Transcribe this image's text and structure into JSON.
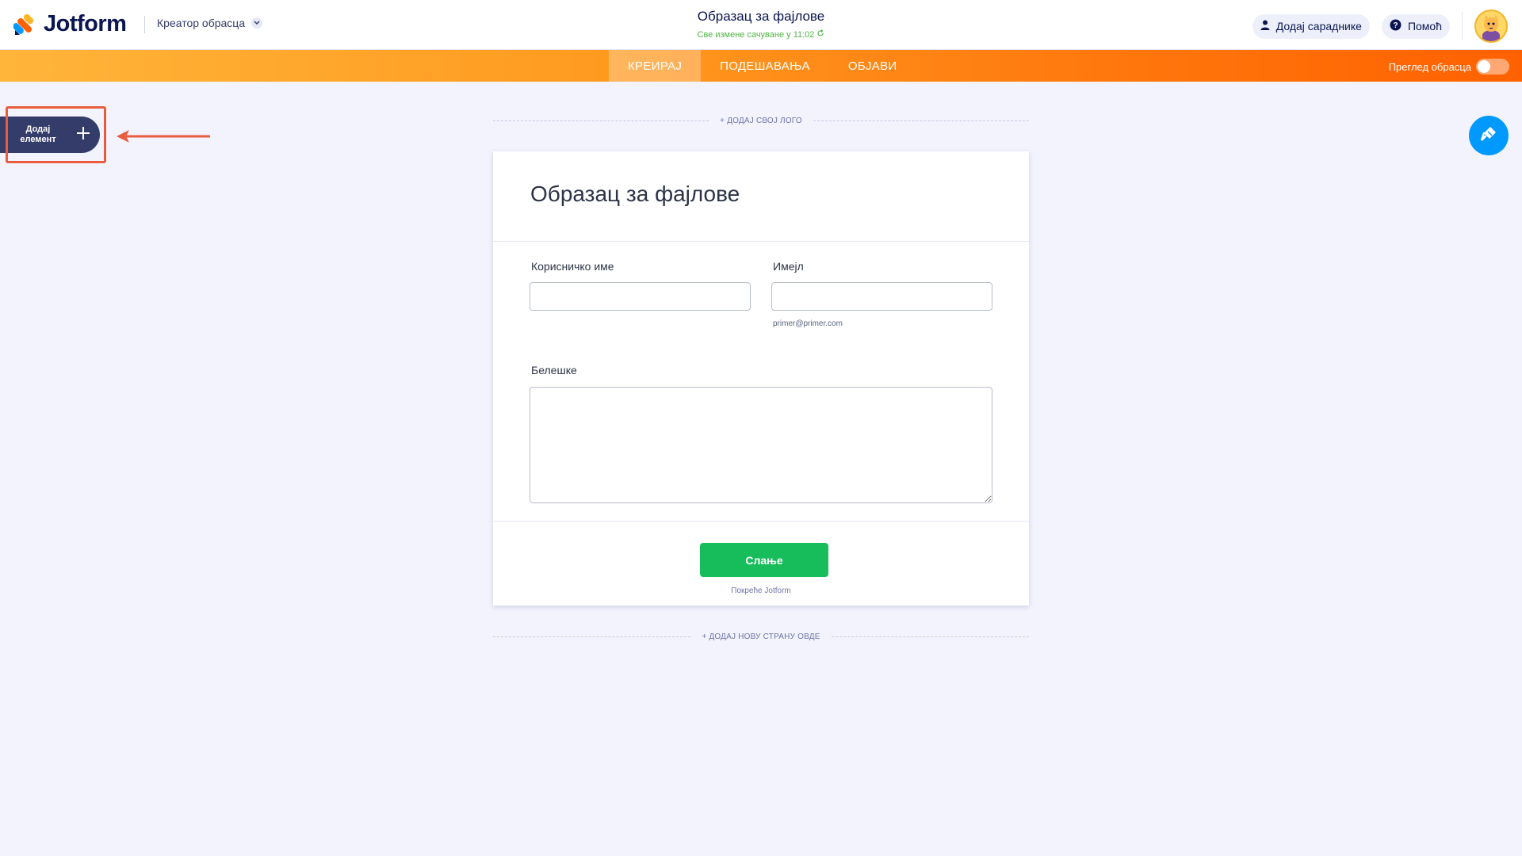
{
  "header": {
    "brand": "Jotform",
    "builder_label": "Креатор обрасца",
    "form_title": "Образац за фајлове",
    "save_status": "Све измене сачуване у 11:02",
    "add_collaborators": "Додај сараднике",
    "help": "Помоћ"
  },
  "nav": {
    "tabs": [
      {
        "label": "КРЕИРАЈ",
        "active": true
      },
      {
        "label": "ПОДЕШАВАЊА",
        "active": false
      },
      {
        "label": "ОБЈАВИ",
        "active": false
      }
    ],
    "preview_label": "Преглед обрасца",
    "preview_on": false
  },
  "sidebar": {
    "add_element_line1": "Додај",
    "add_element_line2": "елемент"
  },
  "canvas": {
    "add_logo": "+ ДОДАЈ СВОЈ ЛОГО",
    "add_page": "+ ДОДАЈ НОВУ СТРАНУ ОВДЕ"
  },
  "form": {
    "title": "Образац за фајлове",
    "fields": {
      "username_label": "Корисничко име",
      "username_value": "",
      "email_label": "Имејл",
      "email_value": "",
      "email_sublabel": "primer@primer.com",
      "notes_label": "Белешке",
      "notes_value": ""
    },
    "submit_label": "Слање",
    "powered_by": "Покреће Jotform"
  },
  "colors": {
    "accent_orange": "#ff6100",
    "navy": "#0a1551",
    "submit_green": "#18bd5b",
    "designer_blue": "#0099ff",
    "highlight": "#e85d3d"
  }
}
